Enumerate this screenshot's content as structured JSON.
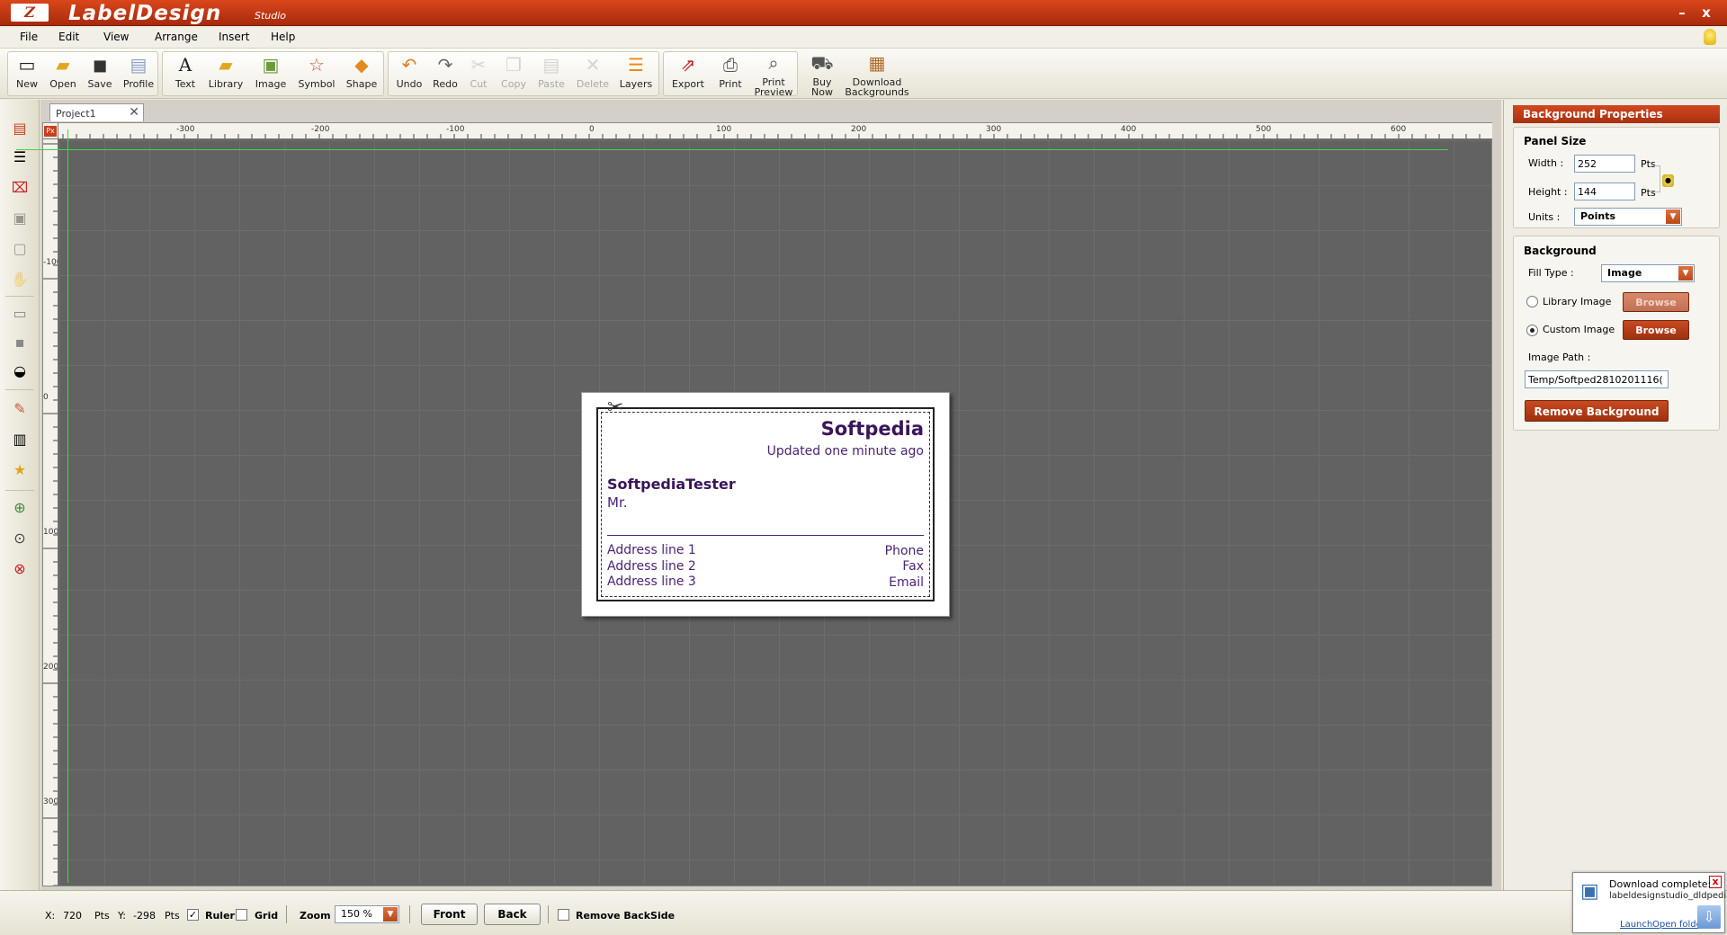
{
  "app": {
    "title": "LabelDesign",
    "subtitle": "Studio",
    "logo": "Z"
  },
  "window_controls": {
    "minimize": "–",
    "close": "x"
  },
  "menu": [
    "File",
    "Edit",
    "View",
    "Arrange",
    "Insert",
    "Help"
  ],
  "toolbar": {
    "new": "New",
    "open": "Open",
    "save": "Save",
    "profile": "Profile",
    "text": "Text",
    "library": "Library",
    "image": "Image",
    "symbol": "Symbol",
    "shape": "Shape",
    "undo": "Undo",
    "redo": "Redo",
    "cut": "Cut",
    "copy": "Copy",
    "paste": "Paste",
    "delete": "Delete",
    "layers": "Layers",
    "export": "Export",
    "print": "Print",
    "print_preview_1": "Print",
    "print_preview_2": "Preview",
    "buy_now_1": "Buy",
    "buy_now_2": "Now",
    "download_bg_1": "Download",
    "download_bg_2": "Backgrounds"
  },
  "tab": {
    "label": "Project1",
    "close": "✕"
  },
  "ruler": {
    "unit": "Px",
    "top_ticks": [
      "-300",
      "-200",
      "-100",
      "0",
      "100",
      "200",
      "300",
      "400",
      "500",
      "600"
    ],
    "left_ticks": [
      "-100",
      "0",
      "100",
      "200",
      "300"
    ]
  },
  "label": {
    "title": "Softpedia",
    "subtitle": "Updated one minute ago",
    "name": "SoftpediaTester",
    "salutation": "Mr.",
    "address": [
      "Address line 1",
      "Address line 2",
      "Address line 3"
    ],
    "contact": [
      "Phone",
      "Fax",
      "Email"
    ]
  },
  "panel": {
    "header": "Background Properties",
    "panel_size": "Panel Size",
    "width_label": "Width :",
    "width_value": "252",
    "width_unit": "Pts",
    "height_label": "Height :",
    "height_value": "144",
    "height_unit": "Pts",
    "units_label": "Units :",
    "units_value": "Points",
    "background": "Background",
    "fill_label": "Fill Type :",
    "fill_value": "Image",
    "library_image": "Library Image",
    "custom_image": "Custom Image",
    "browse": "Browse",
    "image_path_label": "Image Path :",
    "image_path_value": "Temp/Softped2810201116(",
    "remove": "Remove Background"
  },
  "status": {
    "x_label": "X:",
    "x_value": "720",
    "x_unit": "Pts",
    "y_label": "Y:",
    "y_value": "-298",
    "y_unit": "Pts",
    "ruler": "Ruler",
    "ruler_checked": "✓",
    "grid": "Grid",
    "zoom_label": "Zoom :",
    "zoom_value": "150 %",
    "front": "Front",
    "back": "Back",
    "remove_backside": "Remove BackSide"
  },
  "notification": {
    "title": "Download complete:",
    "file": "labeldesignstudio_dldpedia.exe",
    "launch": "Launch",
    "open_folder": "Open folder",
    "close": "x"
  },
  "colors": {
    "accent": "#b8330f",
    "label_text": "#3b145c",
    "canvas": "#626262",
    "guide": "#3fd83f"
  }
}
